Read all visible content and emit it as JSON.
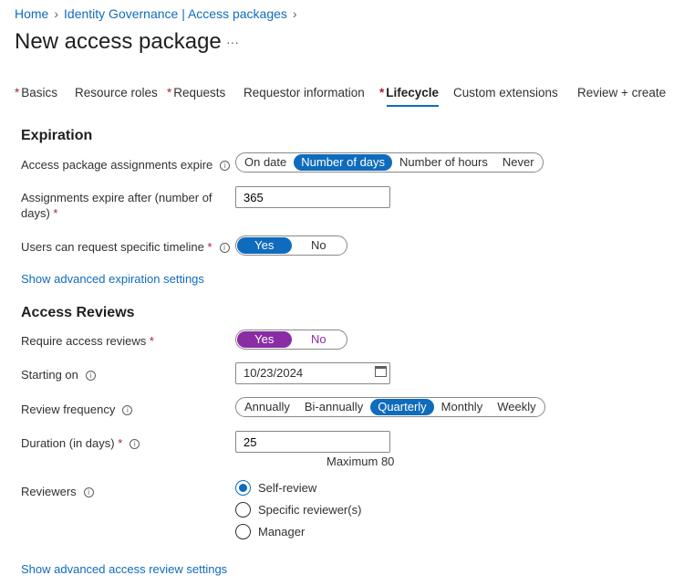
{
  "breadcrumb": [
    "Home",
    "Identity Governance | Access packages"
  ],
  "title": "New access package",
  "more": "···",
  "tabs": [
    {
      "label": "Basics",
      "req": true
    },
    {
      "label": "Resource roles",
      "req": false
    },
    {
      "label": "Requests",
      "req": true
    },
    {
      "label": "Requestor information",
      "req": false
    },
    {
      "label": "Lifecycle",
      "req": true,
      "active": true
    },
    {
      "label": "Custom extensions",
      "req": false
    },
    {
      "label": "Review + create",
      "req": false
    }
  ],
  "expiration": {
    "heading": "Expiration",
    "expire_label": "Access package assignments expire",
    "expire_options": [
      "On date",
      "Number of days",
      "Number of hours",
      "Never"
    ],
    "expire_selected": "Number of days",
    "after_label": "Assignments expire after (number of days)",
    "after_value": "365",
    "timeline_label": "Users can request specific timeline",
    "timeline_yes": "Yes",
    "timeline_no": "No",
    "advanced_link": "Show advanced expiration settings"
  },
  "reviews": {
    "heading": "Access Reviews",
    "require_label": "Require access reviews",
    "require_yes": "Yes",
    "require_no": "No",
    "starting_label": "Starting on",
    "starting_value": "10/23/2024",
    "freq_label": "Review frequency",
    "freq_options": [
      "Annually",
      "Bi-annually",
      "Quarterly",
      "Monthly",
      "Weekly"
    ],
    "freq_selected": "Quarterly",
    "duration_label": "Duration (in days)",
    "duration_value": "25",
    "duration_hint": "Maximum 80",
    "reviewers_label": "Reviewers",
    "reviewer_options": [
      "Self-review",
      "Specific reviewer(s)",
      "Manager"
    ],
    "reviewer_selected": "Self-review",
    "advanced_link": "Show advanced access review settings"
  },
  "colors": {
    "accent": "#0f6cbd",
    "purple": "#8a2da5",
    "required": "#a4262c"
  }
}
